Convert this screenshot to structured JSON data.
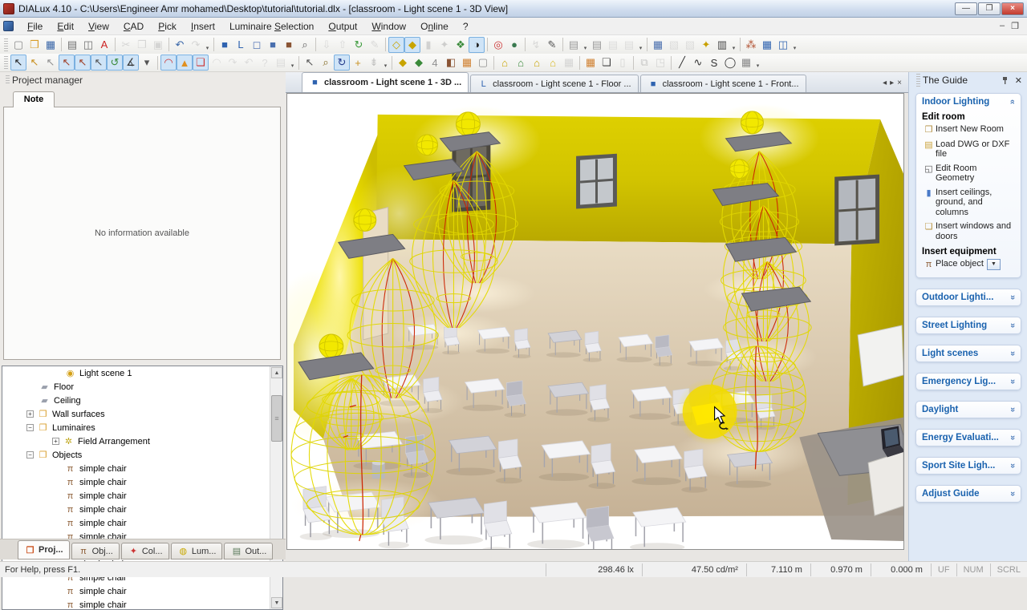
{
  "window": {
    "title": "DIALux 4.10 - C:\\Users\\Engineer Amr mohamed\\Desktop\\tutorial\\tutorial.dlx - [classroom - Light scene 1 - 3D View]",
    "controls": [
      "minimize",
      "restore",
      "close"
    ]
  },
  "menu": {
    "items": [
      {
        "label": "File",
        "u": 0
      },
      {
        "label": "Edit",
        "u": 0
      },
      {
        "label": "View",
        "u": 0
      },
      {
        "label": "CAD",
        "u": 0
      },
      {
        "label": "Pick",
        "u": 0
      },
      {
        "label": "Insert",
        "u": 0
      },
      {
        "label": "Luminaire Selection",
        "u": 10
      },
      {
        "label": "Output",
        "u": 0
      },
      {
        "label": "Window",
        "u": 0
      },
      {
        "label": "Online",
        "u": 1
      },
      {
        "label": "?",
        "u": -1
      }
    ]
  },
  "toolbar1": [
    {
      "n": "new-icon",
      "g": "▢",
      "c": "#8a8a8a"
    },
    {
      "n": "open-icon",
      "g": "❒",
      "c": "#d89c28"
    },
    {
      "n": "save-icon",
      "g": "▦",
      "c": "#3a67a8"
    },
    {
      "sep": true
    },
    {
      "n": "print-icon",
      "g": "▤",
      "c": "#707070"
    },
    {
      "n": "print-preview-icon",
      "g": "◫",
      "c": "#707070"
    },
    {
      "n": "pdf-export-icon",
      "g": "A",
      "c": "#cc2222"
    },
    {
      "sep": true
    },
    {
      "n": "cut-icon",
      "g": "✂",
      "c": "#b0b0b0",
      "dis": true
    },
    {
      "n": "copy-icon",
      "g": "❐",
      "c": "#b0b0b0",
      "dis": true
    },
    {
      "n": "paste-icon",
      "g": "▣",
      "c": "#b0b0b0",
      "dis": true
    },
    {
      "sep": true
    },
    {
      "n": "undo-icon",
      "g": "↶",
      "c": "#3a67a8"
    },
    {
      "n": "redo-icon",
      "g": "↷",
      "c": "#b0b0b0",
      "dis": true,
      "dd": true
    },
    {
      "sep": true
    },
    {
      "n": "cad-cube-icon",
      "g": "■",
      "c": "#2f63b0"
    },
    {
      "n": "cad-plan-icon",
      "g": "L",
      "c": "#2f63b0"
    },
    {
      "n": "cad-box-icon",
      "g": "◻",
      "c": "#5a7ab8"
    },
    {
      "n": "cad-room-icon",
      "g": "■",
      "c": "#4a6fae"
    },
    {
      "n": "cad-brick-icon",
      "g": "■",
      "c": "#8a5434"
    },
    {
      "n": "zoom-region-icon",
      "g": "⌕",
      "c": "#606060"
    },
    {
      "sep": true
    },
    {
      "n": "import-icon",
      "g": "⇩",
      "c": "#b8b8b8",
      "dis": true
    },
    {
      "n": "export-icon",
      "g": "⇧",
      "c": "#b8b8b8",
      "dis": true
    },
    {
      "n": "refresh-icon",
      "g": "↻",
      "c": "#3a9a3a"
    },
    {
      "n": "edit-icon",
      "g": "✎",
      "c": "#b8b8b8",
      "dis": true
    },
    {
      "sep": true
    },
    {
      "n": "wireframe-view-icon",
      "g": "◇",
      "c": "#c8a400",
      "box": true
    },
    {
      "n": "solid-view-icon",
      "g": "◆",
      "c": "#c8a400",
      "box": true
    },
    {
      "n": "light-beam-icon",
      "g": "▮",
      "c": "#c8b400",
      "dis": true
    },
    {
      "n": "star-icon",
      "g": "✦",
      "c": "#a0a0a0",
      "dis": true
    },
    {
      "n": "false-colors-icon",
      "g": "❖",
      "c": "#3a8a3a"
    },
    {
      "n": "curve-icon",
      "g": "◑",
      "c": "#222222",
      "box": true
    },
    {
      "sep": true
    },
    {
      "n": "calc-grid-icon",
      "g": "◎",
      "c": "#cc3333"
    },
    {
      "n": "daylight-globe-icon",
      "g": "●",
      "c": "#3a7a50"
    },
    {
      "sep": true
    },
    {
      "n": "energy-icon",
      "g": "↯",
      "c": "#b8b8b8",
      "dis": true
    },
    {
      "n": "pen-icon",
      "g": "✎",
      "c": "#555555"
    },
    {
      "sep": true
    },
    {
      "n": "table1-icon",
      "g": "▤",
      "c": "#9a9a9a",
      "dd": true
    },
    {
      "n": "table2-icon",
      "g": "▤",
      "c": "#9a9a9a"
    },
    {
      "n": "table3-icon",
      "g": "▤",
      "c": "#c0c0c0",
      "dis": true
    },
    {
      "n": "table4-icon",
      "g": "▤",
      "c": "#c0c0c0",
      "dis": true,
      "dd": true
    },
    {
      "sep": true
    },
    {
      "n": "calculator-icon",
      "g": "▦",
      "c": "#4a6fae"
    },
    {
      "n": "sheet-icon",
      "g": "▧",
      "c": "#c0c0c0",
      "dis": true
    },
    {
      "n": "sheet2-icon",
      "g": "▧",
      "c": "#c0c0c0",
      "dis": true
    },
    {
      "n": "key-icon",
      "g": "✦",
      "c": "#c8a000"
    },
    {
      "n": "output-film-icon",
      "g": "▥",
      "c": "#444444",
      "dd": true
    },
    {
      "sep": true
    },
    {
      "n": "particles-icon",
      "g": "⁂",
      "c": "#b05030"
    },
    {
      "n": "table-view-icon",
      "g": "▦",
      "c": "#2f63b0"
    },
    {
      "n": "columns-view-icon",
      "g": "◫",
      "c": "#2f63b0",
      "dd": true
    }
  ],
  "toolbar2": [
    {
      "n": "select-room-icon",
      "g": "↖",
      "c": "#222222",
      "box": true
    },
    {
      "n": "select-gold-icon",
      "g": "↖",
      "c": "#c89020"
    },
    {
      "n": "select-gray-icon",
      "g": "↖",
      "c": "#909090"
    },
    {
      "n": "select-furniture-icon",
      "g": "↖",
      "c": "#a04028",
      "box": true
    },
    {
      "n": "select-luminaire-icon",
      "g": "↖",
      "c": "#a04028",
      "box": true
    },
    {
      "n": "select-all-icon",
      "g": "↖",
      "c": "#505050",
      "box": true
    },
    {
      "n": "zoom-select-icon",
      "g": "↺",
      "c": "#3a8a3a",
      "box": true
    },
    {
      "n": "measure-icon",
      "g": "∡",
      "c": "#333333",
      "box": true
    },
    {
      "n": "select-more-icon",
      "g": "▾",
      "c": "#555555"
    },
    {
      "sep": true
    },
    {
      "n": "protractor-icon",
      "g": "◠",
      "c": "#cc3333",
      "box": true
    },
    {
      "n": "warning-icon",
      "g": "▲",
      "c": "#e09020",
      "box": true
    },
    {
      "n": "note-red-icon",
      "g": "❏",
      "c": "#cc3333",
      "box": true
    },
    {
      "n": "protractor2-icon",
      "g": "◠",
      "c": "#c0c0c0",
      "dis": true
    },
    {
      "n": "undo-view-icon",
      "g": "↷",
      "c": "#c0c0c0",
      "dis": true
    },
    {
      "n": "redo-view-icon",
      "g": "↶",
      "c": "#c0c0c0",
      "dis": true
    },
    {
      "n": "help-mode-icon",
      "g": "?",
      "c": "#c0c0c0",
      "dis": true
    },
    {
      "n": "print-view-icon",
      "g": "▤",
      "c": "#c0c0c0",
      "dis": true,
      "dd": true
    },
    {
      "sep": true
    },
    {
      "n": "pointer-icon",
      "g": "↖",
      "c": "#555555"
    },
    {
      "n": "zoom-icon",
      "g": "⌕",
      "c": "#806820"
    },
    {
      "n": "orbit-icon",
      "g": "↻",
      "c": "#223a8a",
      "box": true
    },
    {
      "n": "pan-icon",
      "g": "+",
      "c": "#c89020"
    },
    {
      "n": "walk-icon",
      "g": "⇟",
      "c": "#888888",
      "dis": true,
      "dd": true
    },
    {
      "sep": true
    },
    {
      "n": "room-3d-icon",
      "g": "◆",
      "c": "#c8a400"
    },
    {
      "n": "room-green-icon",
      "g": "◆",
      "c": "#3a8a3a"
    },
    {
      "n": "room-gray-icon",
      "g": "4",
      "c": "#909090"
    },
    {
      "n": "room-brown-icon",
      "g": "◧",
      "c": "#8a5434"
    },
    {
      "n": "picture-icon",
      "g": "▦",
      "c": "#d08030"
    },
    {
      "n": "page-icon",
      "g": "▢",
      "c": "#909090"
    },
    {
      "sep": true
    },
    {
      "n": "wall-edit-icon",
      "g": "⌂",
      "c": "#c8a400"
    },
    {
      "n": "wall-green-icon",
      "g": "⌂",
      "c": "#3a8a3a"
    },
    {
      "n": "wall-yellow-icon",
      "g": "⌂",
      "c": "#c8a400"
    },
    {
      "n": "wall-gold-icon",
      "g": "⌂",
      "c": "#d8b820"
    },
    {
      "n": "grid-icon",
      "g": "▦",
      "c": "#b0b0b0",
      "dis": true
    },
    {
      "sep": true
    },
    {
      "n": "window-insert-icon",
      "g": "▦",
      "c": "#d08030"
    },
    {
      "n": "board-icon",
      "g": "❏",
      "c": "#444444"
    },
    {
      "n": "column-insert-icon",
      "g": "▯",
      "c": "#b0b0b0",
      "dis": true
    },
    {
      "sep": true
    },
    {
      "n": "hierarchy-icon",
      "g": "⧉",
      "c": "#909090",
      "dis": true
    },
    {
      "n": "object-move-icon",
      "g": "◳",
      "c": "#b0b0b0",
      "dis": true
    },
    {
      "sep": true
    },
    {
      "n": "line-icon",
      "g": "╱",
      "c": "#333333"
    },
    {
      "n": "polyline-icon",
      "g": "∿",
      "c": "#333333"
    },
    {
      "n": "spline-icon",
      "g": "S",
      "c": "#333333"
    },
    {
      "n": "circle-icon",
      "g": "◯",
      "c": "#333333"
    },
    {
      "n": "grid-table-icon",
      "g": "▦",
      "c": "#888888",
      "dd": true
    }
  ],
  "project_manager": {
    "title": "Project manager",
    "note_tab": "Note",
    "note_empty": "No information available",
    "tree": [
      {
        "lvl": 2,
        "icon": "light-scene",
        "label": "Light scene 1"
      },
      {
        "lvl": 1,
        "icon": "surface",
        "label": "Floor"
      },
      {
        "lvl": 1,
        "icon": "surface",
        "label": "Ceiling"
      },
      {
        "lvl": 1,
        "icon": "folder",
        "label": "Wall surfaces",
        "exp": "+"
      },
      {
        "lvl": 1,
        "icon": "folder",
        "label": "Luminaires",
        "exp": "-"
      },
      {
        "lvl": 2,
        "icon": "field",
        "label": "Field Arrangement",
        "exp": "+"
      },
      {
        "lvl": 1,
        "icon": "folder",
        "label": "Objects",
        "exp": "-"
      },
      {
        "lvl": 2,
        "icon": "chair",
        "label": "simple chair"
      },
      {
        "lvl": 2,
        "icon": "chair",
        "label": "simple chair"
      },
      {
        "lvl": 2,
        "icon": "chair",
        "label": "simple chair"
      },
      {
        "lvl": 2,
        "icon": "chair",
        "label": "simple chair"
      },
      {
        "lvl": 2,
        "icon": "chair",
        "label": "simple chair"
      },
      {
        "lvl": 2,
        "icon": "chair",
        "label": "simple chair"
      },
      {
        "lvl": 2,
        "icon": "chair",
        "label": "simple chair"
      },
      {
        "lvl": 2,
        "icon": "chair",
        "label": "simple chair"
      },
      {
        "lvl": 2,
        "icon": "chair",
        "label": "simple chair"
      },
      {
        "lvl": 2,
        "icon": "chair",
        "label": "simple chair"
      },
      {
        "lvl": 2,
        "icon": "chair",
        "label": "simple chair"
      }
    ],
    "tabs": [
      {
        "label": "Proj...",
        "icon": "project",
        "active": true
      },
      {
        "label": "Obj...",
        "icon": "objects"
      },
      {
        "label": "Col...",
        "icon": "colours"
      },
      {
        "label": "Lum...",
        "icon": "luminaires"
      },
      {
        "label": "Out...",
        "icon": "output"
      }
    ]
  },
  "doc_tabs": [
    {
      "label": "classroom - Light scene 1 - 3D ...",
      "icon": "cube",
      "active": true
    },
    {
      "label": "classroom - Light scene 1 - Floor ...",
      "icon": "plan"
    },
    {
      "label": "classroom - Light scene 1 - Front...",
      "icon": "cube"
    }
  ],
  "guide": {
    "title": "The Guide",
    "expanded": {
      "title": "Indoor Lighting",
      "groups": [
        {
          "heading": "Edit room",
          "items": [
            {
              "icon": "insert-new-room-icon",
              "g": "❒",
              "c": "#b08a3a",
              "label": "Insert New Room"
            },
            {
              "icon": "load-dwg-icon",
              "g": "▤",
              "c": "#caa23a",
              "label": "Load DWG or DXF file"
            },
            {
              "icon": "edit-room-geometry-icon",
              "g": "◱",
              "c": "#555555",
              "label": "Edit Room Geometry"
            },
            {
              "icon": "insert-ceilings-icon",
              "g": "▮",
              "c": "#4a7ac8",
              "label": "Insert ceilings, ground, and columns"
            },
            {
              "icon": "insert-windows-icon",
              "g": "❏",
              "c": "#b8923a",
              "label": "Insert windows and doors"
            }
          ]
        },
        {
          "heading": "Insert equipment",
          "items": [
            {
              "icon": "place-object-icon",
              "g": "π",
              "c": "#8a5a32",
              "label": "Place object",
              "dd": true
            }
          ]
        }
      ]
    },
    "collapsed": [
      "Outdoor Lighti...",
      "Street Lighting",
      "Light scenes",
      "Emergency Lig...",
      "Daylight",
      "Energy Evaluati...",
      "Sport Site Ligh...",
      "Adjust Guide"
    ]
  },
  "status": {
    "help": "For Help, press F1.",
    "fields": [
      "298.46 lx",
      "47.50 cd/m²",
      "7.110 m",
      "0.970 m",
      "0.000 m"
    ],
    "toggles": [
      "UF",
      "NUM",
      "SCRL"
    ]
  }
}
